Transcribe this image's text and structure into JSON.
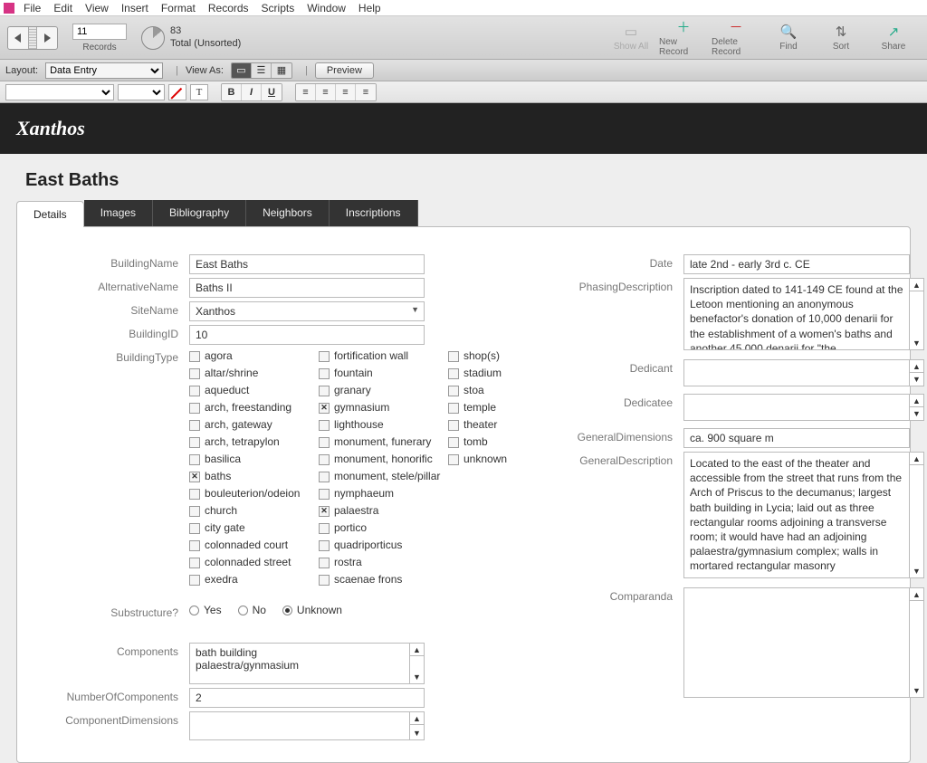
{
  "menu": [
    "File",
    "Edit",
    "View",
    "Insert",
    "Format",
    "Records",
    "Scripts",
    "Window",
    "Help"
  ],
  "record_nav": {
    "current": "11",
    "label": "Records",
    "total": "83",
    "total_label": "Total (Unsorted)"
  },
  "toolbar": {
    "show_all": "Show All",
    "new_record": "New Record",
    "delete_record": "Delete Record",
    "find": "Find",
    "sort": "Sort",
    "share": "Share"
  },
  "layoutbar": {
    "layout_label": "Layout:",
    "layout_value": "Data Entry",
    "view_as": "View As:",
    "preview": "Preview"
  },
  "black_header": "Xanthos",
  "record_title": "East Baths",
  "tabs": [
    "Details",
    "Images",
    "Bibliography",
    "Neighbors",
    "Inscriptions"
  ],
  "left": {
    "labels": {
      "BuildingName": "BuildingName",
      "AlternativeName": "AlternativeName",
      "SiteName": "SiteName",
      "BuildingID": "BuildingID",
      "BuildingType": "BuildingType",
      "Substructure": "Substructure?",
      "Components": "Components",
      "NumberOfComponents": "NumberOfComponents",
      "ComponentDimensions": "ComponentDimensions"
    },
    "BuildingName": "East Baths",
    "AlternativeName": "Baths II",
    "SiteName": "Xanthos",
    "BuildingID": "10",
    "building_types_col1": [
      "agora",
      "altar/shrine",
      "aqueduct",
      "arch, freestanding",
      "arch, gateway",
      "arch, tetrapylon",
      "basilica",
      "baths",
      "bouleuterion/odeion",
      "church",
      "city gate",
      "colonnaded court",
      "colonnaded street",
      "exedra"
    ],
    "building_types_col2": [
      "fortification wall",
      "fountain",
      "granary",
      "gymnasium",
      "lighthouse",
      "monument, funerary",
      "monument, honorific",
      "monument, stele/pillar",
      "nymphaeum",
      "palaestra",
      "portico",
      "quadriporticus",
      "rostra",
      "scaenae frons"
    ],
    "building_types_col3": [
      "shop(s)",
      "stadium",
      "stoa",
      "temple",
      "theater",
      "tomb",
      "unknown"
    ],
    "building_types_checked": [
      "baths",
      "gymnasium",
      "palaestra"
    ],
    "substructure_options": [
      "Yes",
      "No",
      "Unknown"
    ],
    "substructure_value": "Unknown",
    "components": "bath building\npalaestra/gynmasium",
    "NumberOfComponents": "2",
    "ComponentDimensions": ""
  },
  "right": {
    "labels": {
      "Date": "Date",
      "PhasingDescription": "PhasingDescription",
      "Dedicant": "Dedicant",
      "Dedicatee": "Dedicatee",
      "GeneralDimensions": "GeneralDimensions",
      "GeneralDescription": "GeneralDescription",
      "Comparanda": "Comparanda"
    },
    "Date": "late 2nd - early 3rd c. CE",
    "PhasingDescription": "Inscription dated to 141-149 CE found at the Letoon mentioning an anonymous benefactor's donation of 10,000 denarii for the establishment of a women's baths and another 45,000 denarii for \"the",
    "Dedicant": "",
    "Dedicatee": "",
    "GeneralDimensions": "ca. 900 square m",
    "GeneralDescription": "Located to the east of the theater and accessible from the street that runs from the Arch of Priscus to the decumanus; largest bath building in Lycia; laid out as three rectangular rooms adjoining a transverse room; it would have had an adjoining palaestra/gymnasium complex; walls in mortared rectangular masonry",
    "Comparanda": ""
  }
}
